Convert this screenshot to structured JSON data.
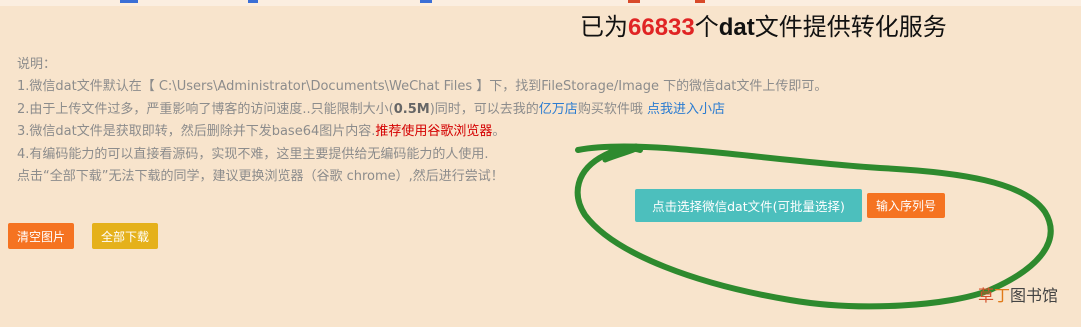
{
  "header": {
    "prefix": "已为",
    "count": "66833",
    "middle": "个",
    "dat": "dat",
    "suffix": "文件提供转化服务"
  },
  "info": {
    "title": "说明：",
    "line1": "1.微信dat文件默认在【  C:\\Users\\Administrator\\Documents\\WeChat Files  】下，找到FileStorage/Image 下的微信dat文件上传即可。",
    "line2_a": "2.由于上传文件过多，严重影响了博客的访问速度..只能限制大小(",
    "line2_b": "0.5M",
    "line2_c": ")同时，可以去我的",
    "line2_link1": "亿万店",
    "line2_d": "购买软件哦",
    "line2_link2": "点我进入小店",
    "line3_a": "3.微信dat文件是获取即转，然后删除并下发base64图片内容.",
    "line3_red": "推荐使用谷歌浏览器",
    "line3_b": "。",
    "line4": "4.有编码能力的可以直接看源码，实现不难，这里主要提供给无编码能力的人使用.",
    "line5": "点击“全部下载”无法下载的同学，建议更换浏览器（谷歌 chrome）,然后进行尝试！"
  },
  "buttons": {
    "clear": "清空图片",
    "download_all": "全部下载",
    "select": "点击选择微信dat文件(可批量选择)",
    "serial": "输入序列号"
  },
  "watermark": {
    "char1": "草",
    "char2": "丁",
    "rest": "图书馆"
  },
  "colors": {
    "background": "#f8e4cc",
    "accent_orange": "#f57321",
    "accent_yellow": "#e5b11b",
    "accent_teal": "#4cbfbd",
    "count_red": "#e02424",
    "scribble_green": "#2e8a2e"
  }
}
